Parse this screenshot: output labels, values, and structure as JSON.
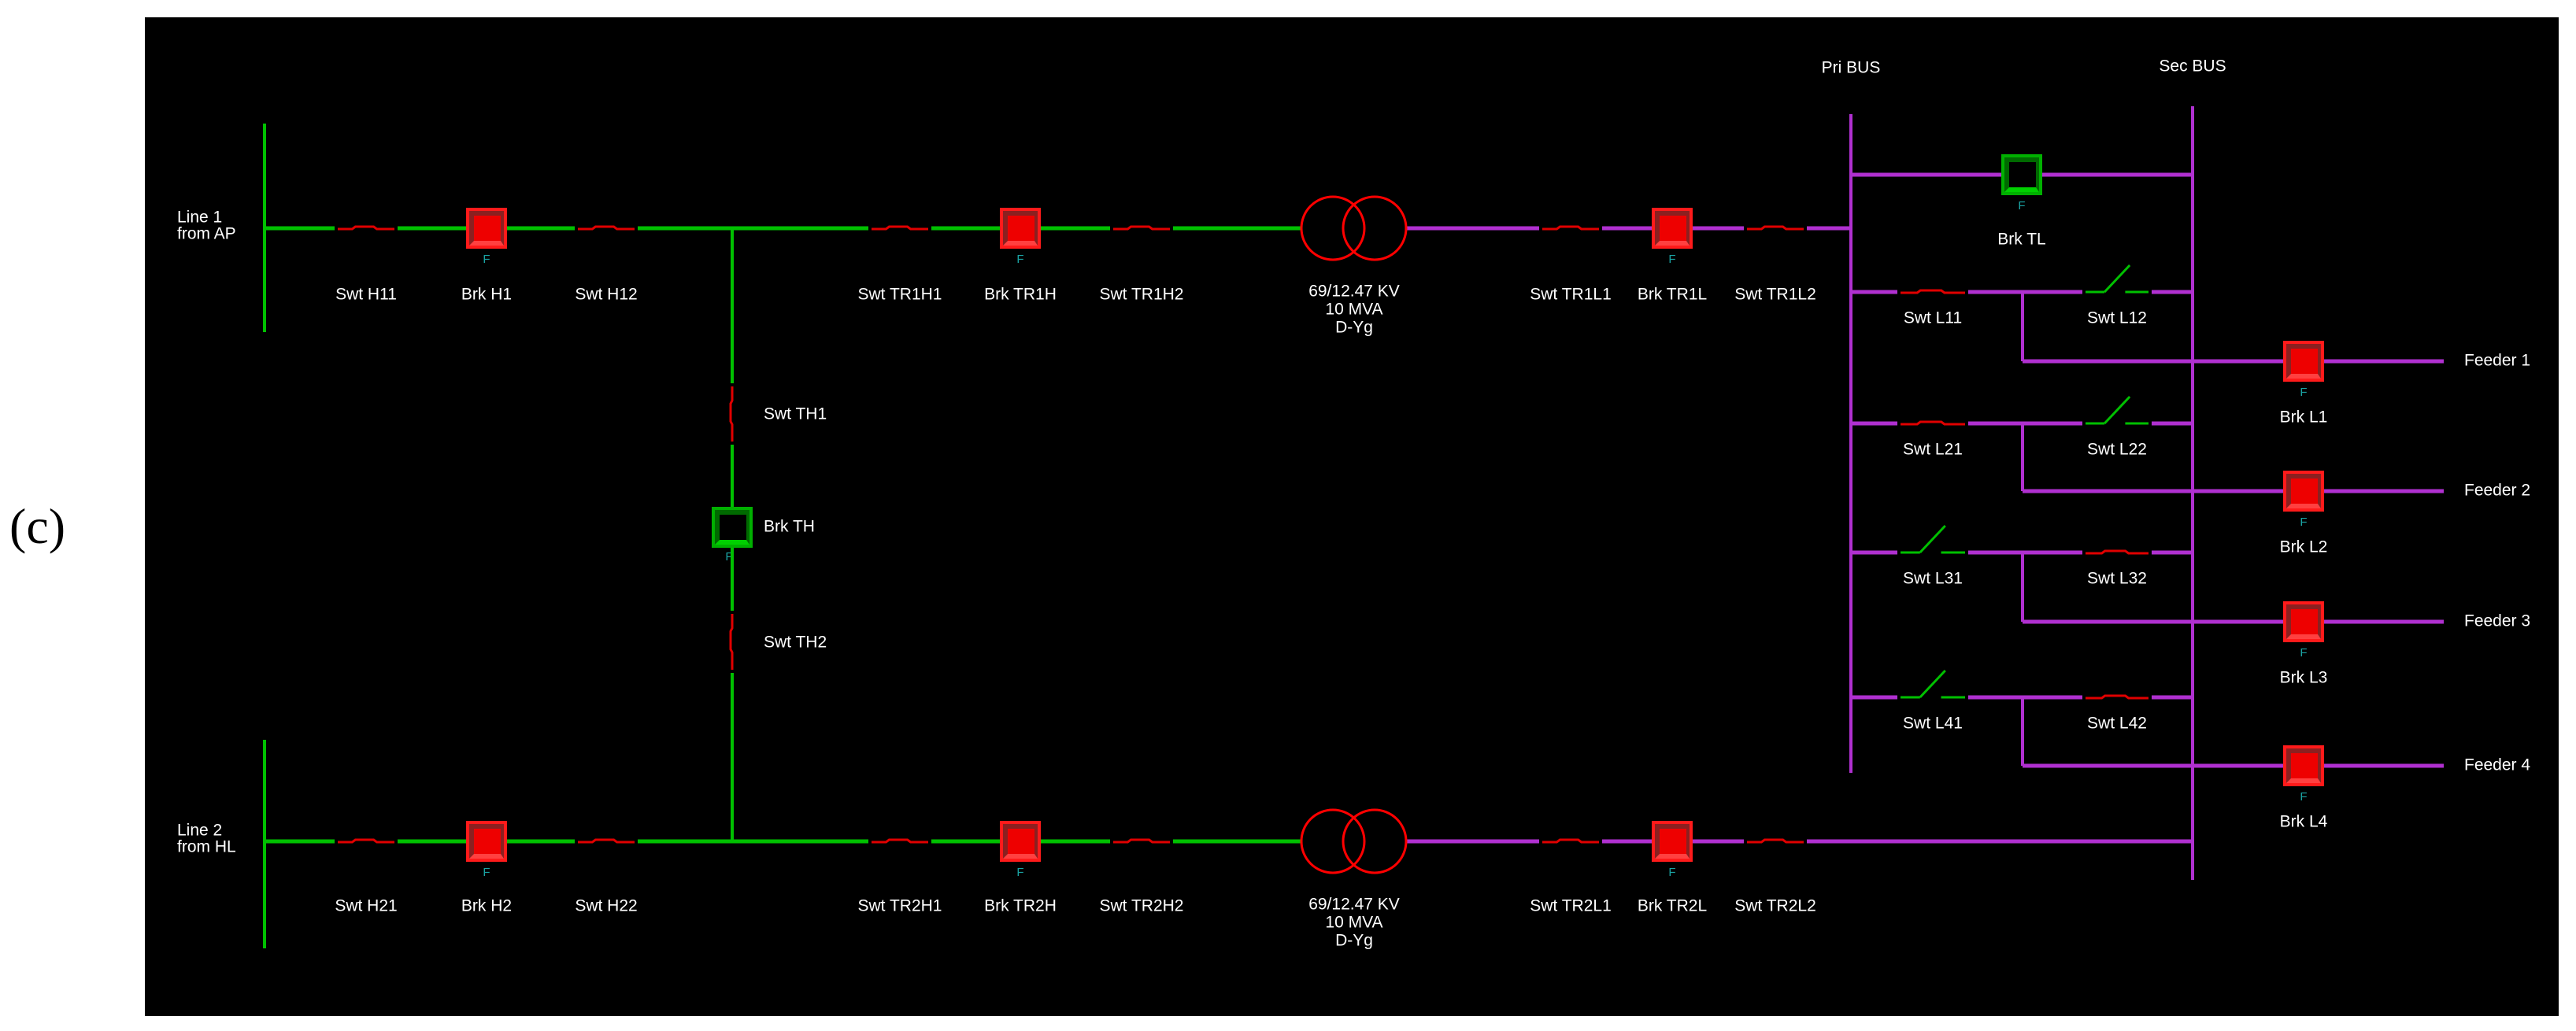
{
  "figure_label": "(c)",
  "colors": {
    "energized_hv": "#00c000",
    "energized_lv": "#b030d0",
    "closed_device": "#e00000",
    "open_device": "#00c000",
    "flag_text": "#1aa3a3",
    "transformer": "#ff0000",
    "background": "#000000",
    "label_text": "#ffffff"
  },
  "sources": [
    {
      "id": "line1",
      "label_lines": [
        "Line 1",
        "from AP"
      ]
    },
    {
      "id": "line2",
      "label_lines": [
        "Line 2",
        "from HL"
      ]
    }
  ],
  "buses": {
    "pri": {
      "label": "Pri BUS"
    },
    "sec": {
      "label": "Sec BUS"
    }
  },
  "rows": [
    {
      "id": "row1",
      "devices": [
        {
          "type": "switch",
          "label": "Swt H11",
          "state": "closed"
        },
        {
          "type": "breaker",
          "label": "Brk H1",
          "state": "closed",
          "flag": "F"
        },
        {
          "type": "switch",
          "label": "Swt H12",
          "state": "closed"
        },
        {
          "type": "switch",
          "label": "Swt TR1H1",
          "state": "closed"
        },
        {
          "type": "breaker",
          "label": "Brk TR1H",
          "state": "closed",
          "flag": "F"
        },
        {
          "type": "switch",
          "label": "Swt TR1H2",
          "state": "closed"
        },
        {
          "type": "transformer",
          "label_lines": [
            "69/12.47 KV",
            "10 MVA",
            "D-Yg"
          ]
        },
        {
          "type": "switch",
          "label": "Swt TR1L1",
          "state": "closed"
        },
        {
          "type": "breaker",
          "label": "Brk TR1L",
          "state": "closed",
          "flag": "F"
        },
        {
          "type": "switch",
          "label": "Swt TR1L2",
          "state": "closed"
        }
      ]
    },
    {
      "id": "row2",
      "devices": [
        {
          "type": "switch",
          "label": "Swt H21",
          "state": "closed"
        },
        {
          "type": "breaker",
          "label": "Brk H2",
          "state": "closed",
          "flag": "F"
        },
        {
          "type": "switch",
          "label": "Swt H22",
          "state": "closed"
        },
        {
          "type": "switch",
          "label": "Swt TR2H1",
          "state": "closed"
        },
        {
          "type": "breaker",
          "label": "Brk TR2H",
          "state": "closed",
          "flag": "F"
        },
        {
          "type": "switch",
          "label": "Swt TR2H2",
          "state": "closed"
        },
        {
          "type": "transformer",
          "label_lines": [
            "69/12.47 KV",
            "10 MVA",
            "D-Yg"
          ]
        },
        {
          "type": "switch",
          "label": "Swt TR2L1",
          "state": "closed"
        },
        {
          "type": "breaker",
          "label": "Brk TR2L",
          "state": "closed",
          "flag": "F"
        },
        {
          "type": "switch",
          "label": "Swt TR2L2",
          "state": "closed"
        }
      ]
    }
  ],
  "tie_hv": {
    "devices": [
      {
        "type": "switch",
        "label": "Swt TH1",
        "state": "closed"
      },
      {
        "type": "breaker",
        "label": "Brk TH",
        "state": "open",
        "flag": "F"
      },
      {
        "type": "switch",
        "label": "Swt TH2",
        "state": "closed"
      }
    ]
  },
  "tie_lv": {
    "type": "breaker",
    "label": "Brk TL",
    "state": "open",
    "flag": "F"
  },
  "feeders": [
    {
      "label": "Feeder 1",
      "pri_switch": {
        "label": "Swt L11",
        "state": "closed"
      },
      "sec_switch": {
        "label": "Swt L12",
        "state": "open"
      },
      "breaker": {
        "label": "Brk L1",
        "state": "closed",
        "flag": "F"
      }
    },
    {
      "label": "Feeder 2",
      "pri_switch": {
        "label": "Swt L21",
        "state": "closed"
      },
      "sec_switch": {
        "label": "Swt L22",
        "state": "open"
      },
      "breaker": {
        "label": "Brk L2",
        "state": "closed",
        "flag": "F"
      }
    },
    {
      "label": "Feeder 3",
      "pri_switch": {
        "label": "Swt L31",
        "state": "open"
      },
      "sec_switch": {
        "label": "Swt L32",
        "state": "closed"
      },
      "breaker": {
        "label": "Brk L3",
        "state": "closed",
        "flag": "F"
      }
    },
    {
      "label": "Feeder 4",
      "pri_switch": {
        "label": "Swt L41",
        "state": "open"
      },
      "sec_switch": {
        "label": "Swt L42",
        "state": "closed"
      },
      "breaker": {
        "label": "Brk L4",
        "state": "closed",
        "flag": "F"
      }
    }
  ]
}
